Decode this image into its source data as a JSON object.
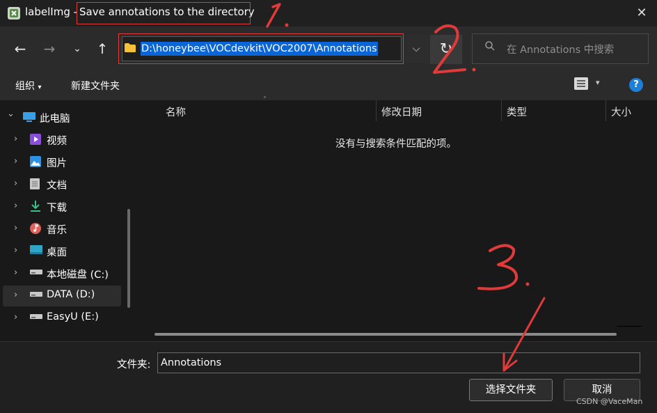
{
  "window": {
    "app_name": "labelImg -",
    "title": "Save annotations to the directory",
    "close_icon": "close-icon"
  },
  "nav": {
    "back_icon": "arrow-left-icon",
    "forward_icon": "arrow-right-icon",
    "recent_icon": "chevron-down-icon",
    "up_icon": "arrow-up-icon",
    "address_path": "D:\\honeybee\\VOCdevkit\\VOC2007\\Annotations",
    "refresh_icon": "refresh-icon",
    "search_placeholder": "在 Annotations 中搜索"
  },
  "toolbar": {
    "organize_label": "组织",
    "new_folder_label": "新建文件夹",
    "help_label": "?"
  },
  "sidebar": {
    "items": [
      {
        "label": "此电脑",
        "icon": "computer-icon"
      },
      {
        "label": "视频",
        "icon": "video-icon"
      },
      {
        "label": "图片",
        "icon": "picture-icon"
      },
      {
        "label": "文档",
        "icon": "document-icon"
      },
      {
        "label": "下载",
        "icon": "download-icon"
      },
      {
        "label": "音乐",
        "icon": "music-icon"
      },
      {
        "label": "桌面",
        "icon": "desktop-icon"
      },
      {
        "label": "本地磁盘 (C:)",
        "icon": "drive-icon"
      },
      {
        "label": "DATA (D:)",
        "icon": "drive-icon"
      },
      {
        "label": "EasyU (E:)",
        "icon": "drive-icon"
      }
    ],
    "selected": "DATA (D:)"
  },
  "file_list": {
    "columns": [
      "名称",
      "修改日期",
      "类型",
      "大小"
    ],
    "empty_message": "没有与搜索条件匹配的项。"
  },
  "bottom": {
    "folder_label": "文件夹:",
    "folder_value": "Annotations",
    "select_button": "选择文件夹",
    "cancel_button": "取消"
  },
  "annotations": {
    "step1": "1.",
    "step2": "2.",
    "step3": "3.",
    "color": "#e03a3a"
  },
  "watermark": "CSDN @VaceMan",
  "colors": {
    "background": "#202020",
    "selection": "#0a66d6",
    "folder": "#f4c13a",
    "help": "#1e7fd9"
  }
}
